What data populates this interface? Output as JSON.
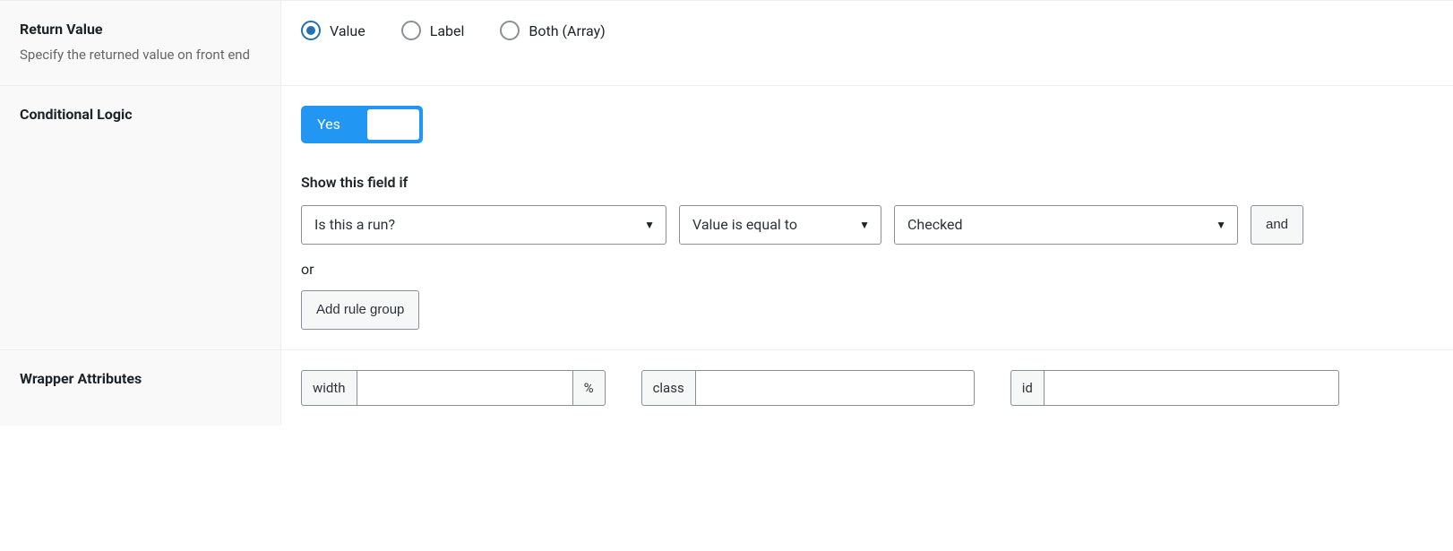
{
  "returnValue": {
    "title": "Return Value",
    "desc": "Specify the returned value on front end",
    "options": {
      "value": "Value",
      "label": "Label",
      "both": "Both (Array)"
    },
    "selected": "value"
  },
  "conditionalLogic": {
    "title": "Conditional Logic",
    "toggleLabel": "Yes",
    "subhead": "Show this field if",
    "rule": {
      "field": "Is this a run?",
      "operator": "Value is equal to",
      "value": "Checked"
    },
    "andLabel": "and",
    "orLabel": "or",
    "addGroupLabel": "Add rule group"
  },
  "wrapper": {
    "title": "Wrapper Attributes",
    "width": {
      "label": "width",
      "suffix": "%",
      "value": ""
    },
    "class": {
      "label": "class",
      "value": ""
    },
    "id": {
      "label": "id",
      "value": ""
    }
  }
}
